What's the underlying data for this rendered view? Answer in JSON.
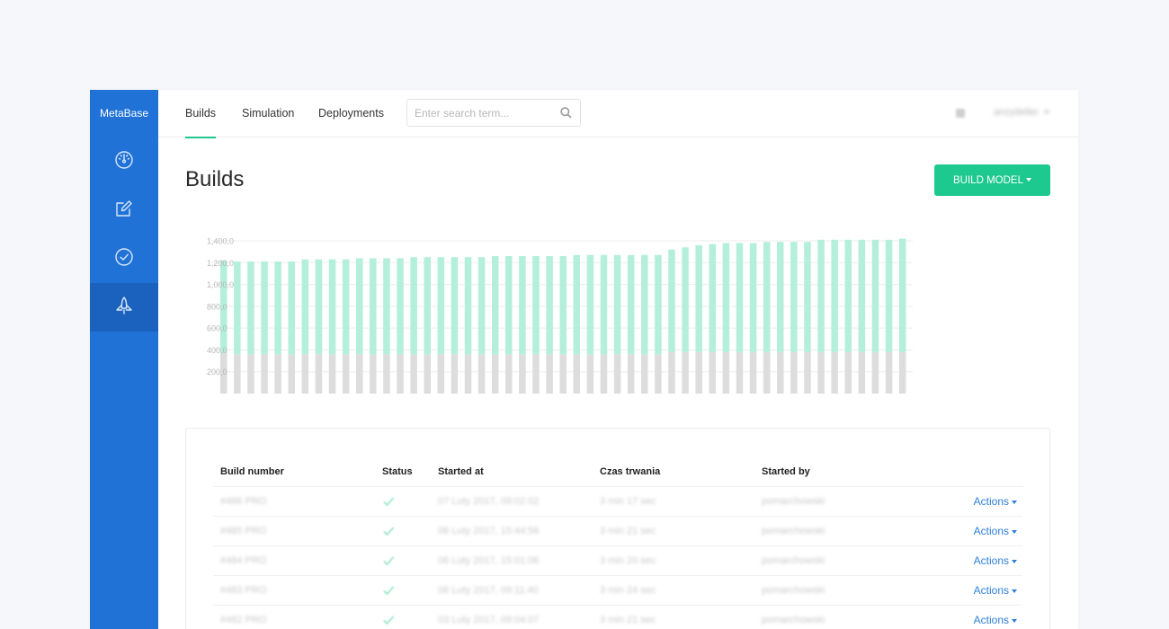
{
  "app": {
    "brand": "MetaBase",
    "user_name": "anzydeller"
  },
  "sidebar": {
    "items": [
      {
        "icon": "dashboard-gauge-icon",
        "active": false
      },
      {
        "icon": "edit-icon",
        "active": false
      },
      {
        "icon": "check-circle-icon",
        "active": false
      },
      {
        "icon": "rocket-icon",
        "active": true
      }
    ]
  },
  "nav": {
    "tabs": [
      {
        "label": "Builds",
        "active": true
      },
      {
        "label": "Simulation",
        "active": false
      },
      {
        "label": "Deployments",
        "active": false
      }
    ]
  },
  "search": {
    "placeholder": "Enter search term...",
    "value": ""
  },
  "page": {
    "title": "Builds",
    "build_button_label": "BUILD MODEL"
  },
  "colors": {
    "sidebar": "#2072d6",
    "sidebar_active": "#1a62be",
    "accent": "#1ec98f",
    "bar_top": "#b3efda",
    "bar_bottom": "#dddddd",
    "link": "#2f80d8"
  },
  "chart_data": {
    "type": "bar",
    "stacked": true,
    "ylim": [
      0,
      1400
    ],
    "y_ticks": [
      "1,400,0",
      "1,200,0",
      "1,000,0",
      "800,0",
      "600,0",
      "400,0",
      "200,0"
    ],
    "grid": true,
    "legend": "none",
    "series": [
      {
        "values": [
          370,
          360,
          360,
          360,
          360,
          360,
          360,
          360,
          360,
          360,
          360,
          360,
          360,
          360,
          360,
          360,
          360,
          360,
          360,
          360,
          360,
          360,
          360,
          360,
          360,
          360,
          360,
          360,
          360,
          360,
          360,
          360,
          360,
          380,
          380,
          380,
          380,
          380,
          380,
          380,
          380,
          380,
          380,
          380,
          380,
          380,
          380,
          380,
          380,
          380,
          380
        ]
      },
      {
        "values": [
          850,
          850,
          850,
          850,
          850,
          850,
          870,
          870,
          870,
          870,
          880,
          880,
          880,
          880,
          890,
          890,
          890,
          890,
          890,
          890,
          900,
          900,
          900,
          900,
          900,
          900,
          910,
          910,
          910,
          910,
          910,
          910,
          910,
          940,
          960,
          980,
          990,
          1000,
          1000,
          1000,
          1010,
          1010,
          1010,
          1010,
          1030,
          1030,
          1030,
          1030,
          1030,
          1030,
          1040
        ]
      }
    ]
  },
  "table": {
    "columns": [
      "Build number",
      "Status",
      "Started at",
      "Czas trwania",
      "Started by"
    ],
    "action_label": "Actions",
    "rows": [
      {
        "build": "#486 PRO",
        "started_at": "07 Luty 2017, 09:02:02",
        "duration": "3 min 17 sec",
        "started_by": "pomarchowski",
        "status": "success"
      },
      {
        "build": "#485 PRO",
        "started_at": "06 Luty 2017, 15:44:56",
        "duration": "3 min 21 sec",
        "started_by": "pomarchowski",
        "status": "success"
      },
      {
        "build": "#484 PRO",
        "started_at": "06 Luty 2017, 15:01:06",
        "duration": "3 min 20 sec",
        "started_by": "pomarchowski",
        "status": "success"
      },
      {
        "build": "#483 PRO",
        "started_at": "06 Luty 2017, 09:11:40",
        "duration": "3 min 24 sec",
        "started_by": "pomarchowski",
        "status": "success"
      },
      {
        "build": "#482 PRO",
        "started_at": "03 Luty 2017, 09:04:07",
        "duration": "3 min 21 sec",
        "started_by": "pomarchowski",
        "status": "success"
      }
    ]
  }
}
